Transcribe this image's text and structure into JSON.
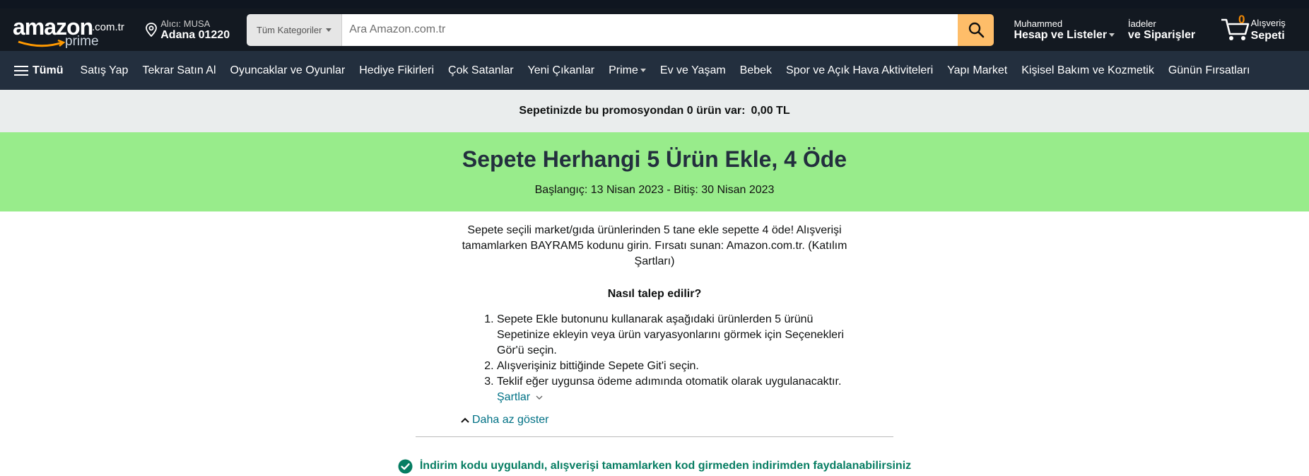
{
  "header": {
    "logo_text": "amazon",
    "logo_tld": ".com.tr",
    "logo_prime": "prime",
    "deliver_label": "Alıcı: MUSA",
    "deliver_location": "Adana 01220",
    "search_category": "Tüm Kategoriler",
    "search_placeholder": "Ara Amazon.com.tr",
    "account_name": "Muhammed",
    "account_label": "Hesap ve Listeler",
    "returns_label": "İadeler",
    "orders_label": "ve Siparişler",
    "cart_count": "0",
    "cart_label_1": "Alışveriş",
    "cart_label_2": "Sepeti"
  },
  "subnav": {
    "all_label": "Tümü",
    "items": [
      "Satış Yap",
      "Tekrar Satın Al",
      "Oyuncaklar ve Oyunlar",
      "Hediye Fikirleri",
      "Çok Satanlar",
      "Yeni Çıkanlar",
      "Prime",
      "Ev ve Yaşam",
      "Bebek",
      "Spor ve Açık Hava Aktiviteleri",
      "Yapı Market",
      "Kişisel Bakım ve Kozmetik",
      "Günün Fırsatları"
    ]
  },
  "promo_bar": {
    "text": "Sepetinizde bu promosyondan 0 ürün var:",
    "amount": "0,00 TL"
  },
  "hero": {
    "title": "Sepete Herhangi 5 Ürün Ekle, 4 Öde",
    "dates": "Başlangıç: 13 Nisan 2023 - Bitiş: 30 Nisan 2023"
  },
  "description": "Sepete seçili market/gıda ürünlerinden 5 tane ekle sepette 4 öde! Alışverişi tamamlarken BAYRAM5 kodunu girin. Fırsatı sunan: Amazon.com.tr. (Katılım Şartları)",
  "how_title": "Nasıl talep edilir?",
  "steps": [
    "Sepete Ekle butonunu kullanarak aşağıdaki ürünlerden 5 ürünü Sepetinize ekleyin veya ürün varyasyonlarını görmek için Seçenekleri Gör'ü seçin.",
    "Alışverişiniz bittiğinde Sepete Git'i seçin.",
    "Teklif eğer uygunsa ödeme adımında otomatik olarak uygulanacaktır."
  ],
  "terms_link": "Şartlar",
  "show_less": "Daha az göster",
  "applied_message": "İndirim kodu uygulandı, alışverişi tamamlarken kod girmeden indirimden faydalanabilirsiniz",
  "colors": {
    "nav_bg": "#131921",
    "subnav_bg": "#232f3e",
    "search_button": "#febd69",
    "hero_bg": "#98ec8b",
    "link": "#007185",
    "success": "#067d62",
    "cart_count": "#f08804"
  }
}
